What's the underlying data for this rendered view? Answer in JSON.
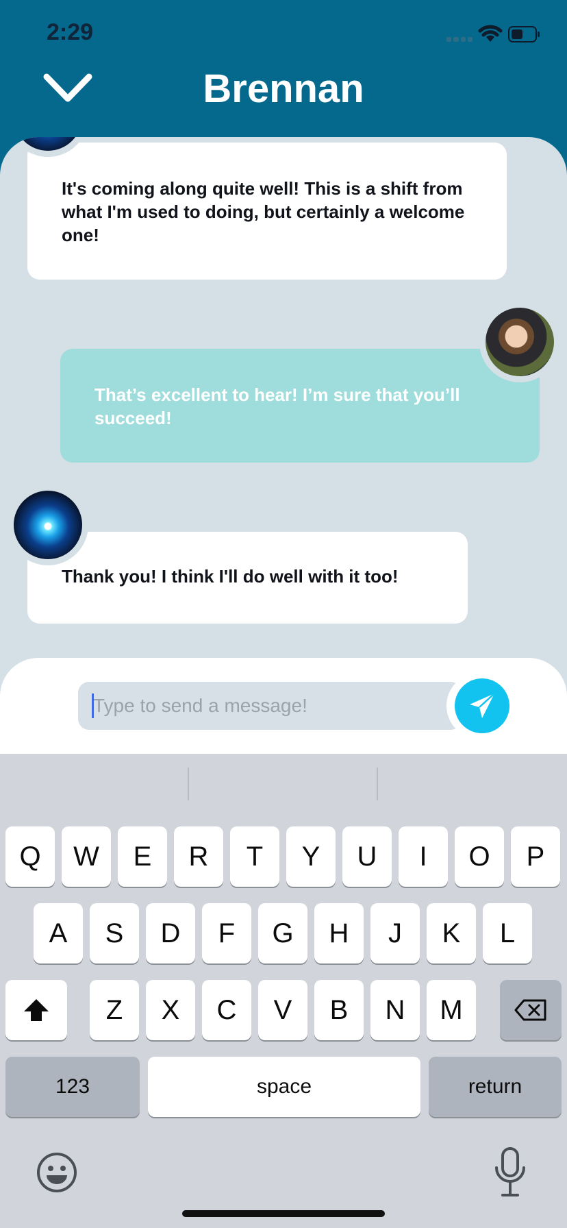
{
  "status_bar": {
    "time": "2:29"
  },
  "header": {
    "title": "Brennan"
  },
  "messages": [
    {
      "sender": "contact",
      "text": "It's coming along quite well! This is a shift from what I'm used to doing, but certainly a welcome one!"
    },
    {
      "sender": "me",
      "text": "That’s excellent to hear! I’m sure that you’ll succeed!"
    },
    {
      "sender": "contact",
      "text": "Thank you! I think I'll do well with it too!"
    }
  ],
  "composer": {
    "placeholder": "Type to send a message!"
  },
  "keyboard": {
    "row1": [
      "Q",
      "W",
      "E",
      "R",
      "T",
      "Y",
      "U",
      "I",
      "O",
      "P"
    ],
    "row2": [
      "A",
      "S",
      "D",
      "F",
      "G",
      "H",
      "J",
      "K",
      "L"
    ],
    "row3": [
      "Z",
      "X",
      "C",
      "V",
      "B",
      "N",
      "M"
    ],
    "numbers_label": "123",
    "space_label": "space",
    "return_label": "return"
  },
  "colors": {
    "header": "#04698d",
    "chat_bg": "#d5dfe6",
    "outgoing_bubble": "#9fdcdc",
    "send_button": "#12c3ef"
  },
  "icons": [
    "chevron-down-icon",
    "send-icon",
    "shift-icon",
    "backspace-icon",
    "emoji-icon",
    "microphone-icon",
    "wifi-icon",
    "battery-icon"
  ]
}
